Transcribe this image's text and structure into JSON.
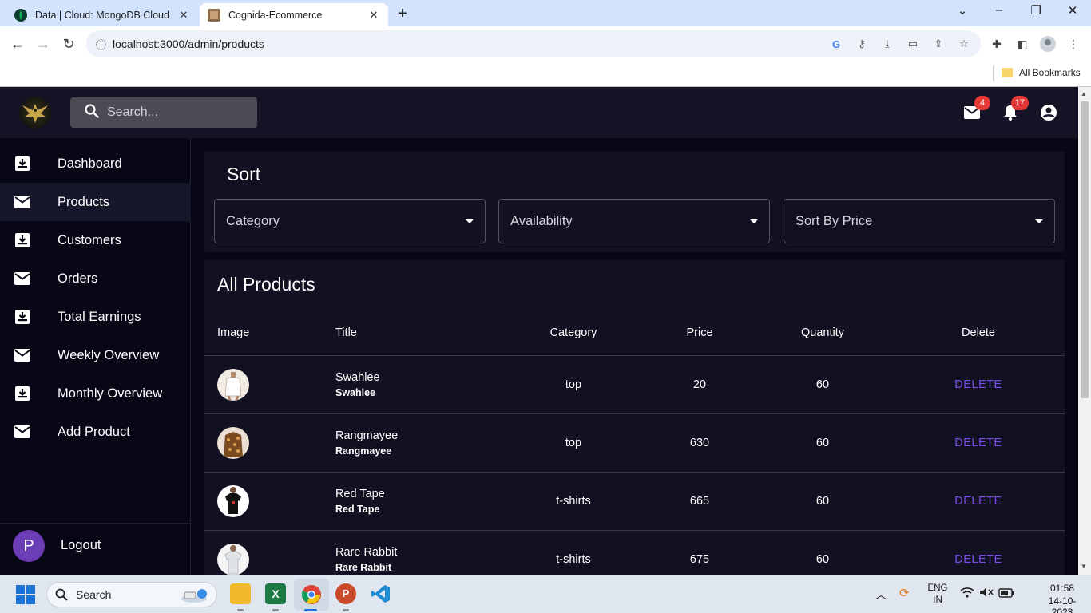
{
  "browser": {
    "tabs": [
      {
        "title": "Data | Cloud: MongoDB Cloud",
        "favicon": "mongodb-leaf-icon",
        "active": false
      },
      {
        "title": "Cognida-Ecommerce",
        "favicon": "site-icon",
        "active": true
      }
    ],
    "url": "localhost:3000/admin/products",
    "bookmarks_label": "All Bookmarks"
  },
  "appbar": {
    "search_placeholder": "Search...",
    "mail_count": "4",
    "notification_count": "17"
  },
  "sidebar": {
    "items": [
      {
        "label": "Dashboard",
        "icon": "inbox-download-icon"
      },
      {
        "label": "Products",
        "icon": "mail-icon",
        "selected": true
      },
      {
        "label": "Customers",
        "icon": "inbox-download-icon"
      },
      {
        "label": "Orders",
        "icon": "mail-icon"
      },
      {
        "label": "Total Earnings",
        "icon": "inbox-download-icon"
      },
      {
        "label": "Weekly Overview",
        "icon": "mail-icon"
      },
      {
        "label": "Monthly Overview",
        "icon": "inbox-download-icon"
      },
      {
        "label": "Add Product",
        "icon": "mail-icon"
      }
    ],
    "avatar_letter": "P",
    "logout_label": "Logout"
  },
  "sort": {
    "title": "Sort",
    "filters": [
      "Category",
      "Availability",
      "Sort By Price"
    ]
  },
  "products": {
    "title": "All Products",
    "columns": [
      "Image",
      "Title",
      "Category",
      "Price",
      "Quantity",
      "Delete"
    ],
    "rows": [
      {
        "title": "Swahlee",
        "subtitle": "Swahlee",
        "category": "top",
        "price": "20",
        "quantity": "60",
        "action": "DELETE"
      },
      {
        "title": "Rangmayee",
        "subtitle": "Rangmayee",
        "category": "top",
        "price": "630",
        "quantity": "60",
        "action": "DELETE"
      },
      {
        "title": "Red Tape",
        "subtitle": "Red Tape",
        "category": "t-shirts",
        "price": "665",
        "quantity": "60",
        "action": "DELETE"
      },
      {
        "title": "Rare Rabbit",
        "subtitle": "Rare Rabbit",
        "category": "t-shirts",
        "price": "675",
        "quantity": "60",
        "action": "DELETE"
      }
    ]
  },
  "taskbar": {
    "search_label": "Search",
    "language": "ENG",
    "region": "IN",
    "time": "01:58",
    "date": "14-10-2023"
  },
  "colors": {
    "accent": "#7b4de8",
    "badge": "#e53935",
    "background": "#070716",
    "card": "#111122"
  }
}
